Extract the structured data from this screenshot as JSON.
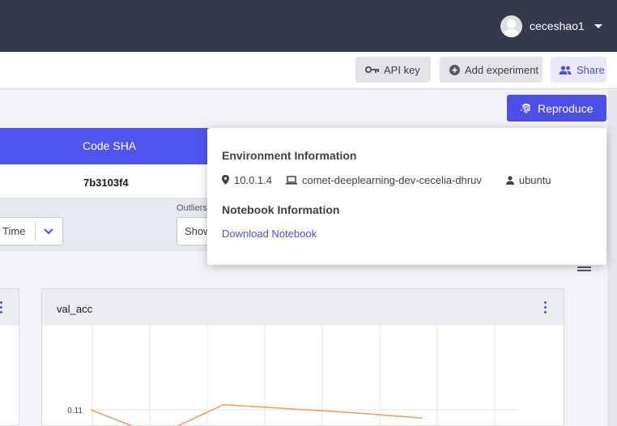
{
  "header": {
    "username": "ceceshao1"
  },
  "toolbar": {
    "api_key_label": "API key",
    "add_experiment_label": "Add experiment",
    "share_label": "Share"
  },
  "reproduce_label": "Reproduce",
  "table": {
    "columns": [
      "Code SHA"
    ],
    "rows": [
      [
        "7b3103f4"
      ]
    ]
  },
  "filters": {
    "x_axis_value": "Time",
    "outliers_label": "Outliers",
    "outliers_value": "Show"
  },
  "popover": {
    "environment_title": "Environment Information",
    "ip": "10.0.1.4",
    "hostname": "comet-deeplearning-dev-cecelia-dhruv",
    "os_user": "ubuntu",
    "notebook_title": "Notebook Information",
    "download_link": "Download Notebook"
  },
  "panel": {
    "title": "val_acc"
  },
  "chart_data": {
    "type": "line",
    "title": "val_acc",
    "y_tick_labels": [
      "0.11"
    ],
    "series": [
      {
        "x": [
          0,
          1,
          2,
          3,
          4,
          5
        ],
        "y": [
          0.11,
          0.085,
          0.115,
          0.111,
          0.107,
          0.102
        ]
      }
    ],
    "grid": true,
    "line_color": "#f39a56"
  },
  "colors": {
    "primary": "#4c4ee8",
    "topbar": "#343a4b",
    "table_header": "#5155f0"
  }
}
